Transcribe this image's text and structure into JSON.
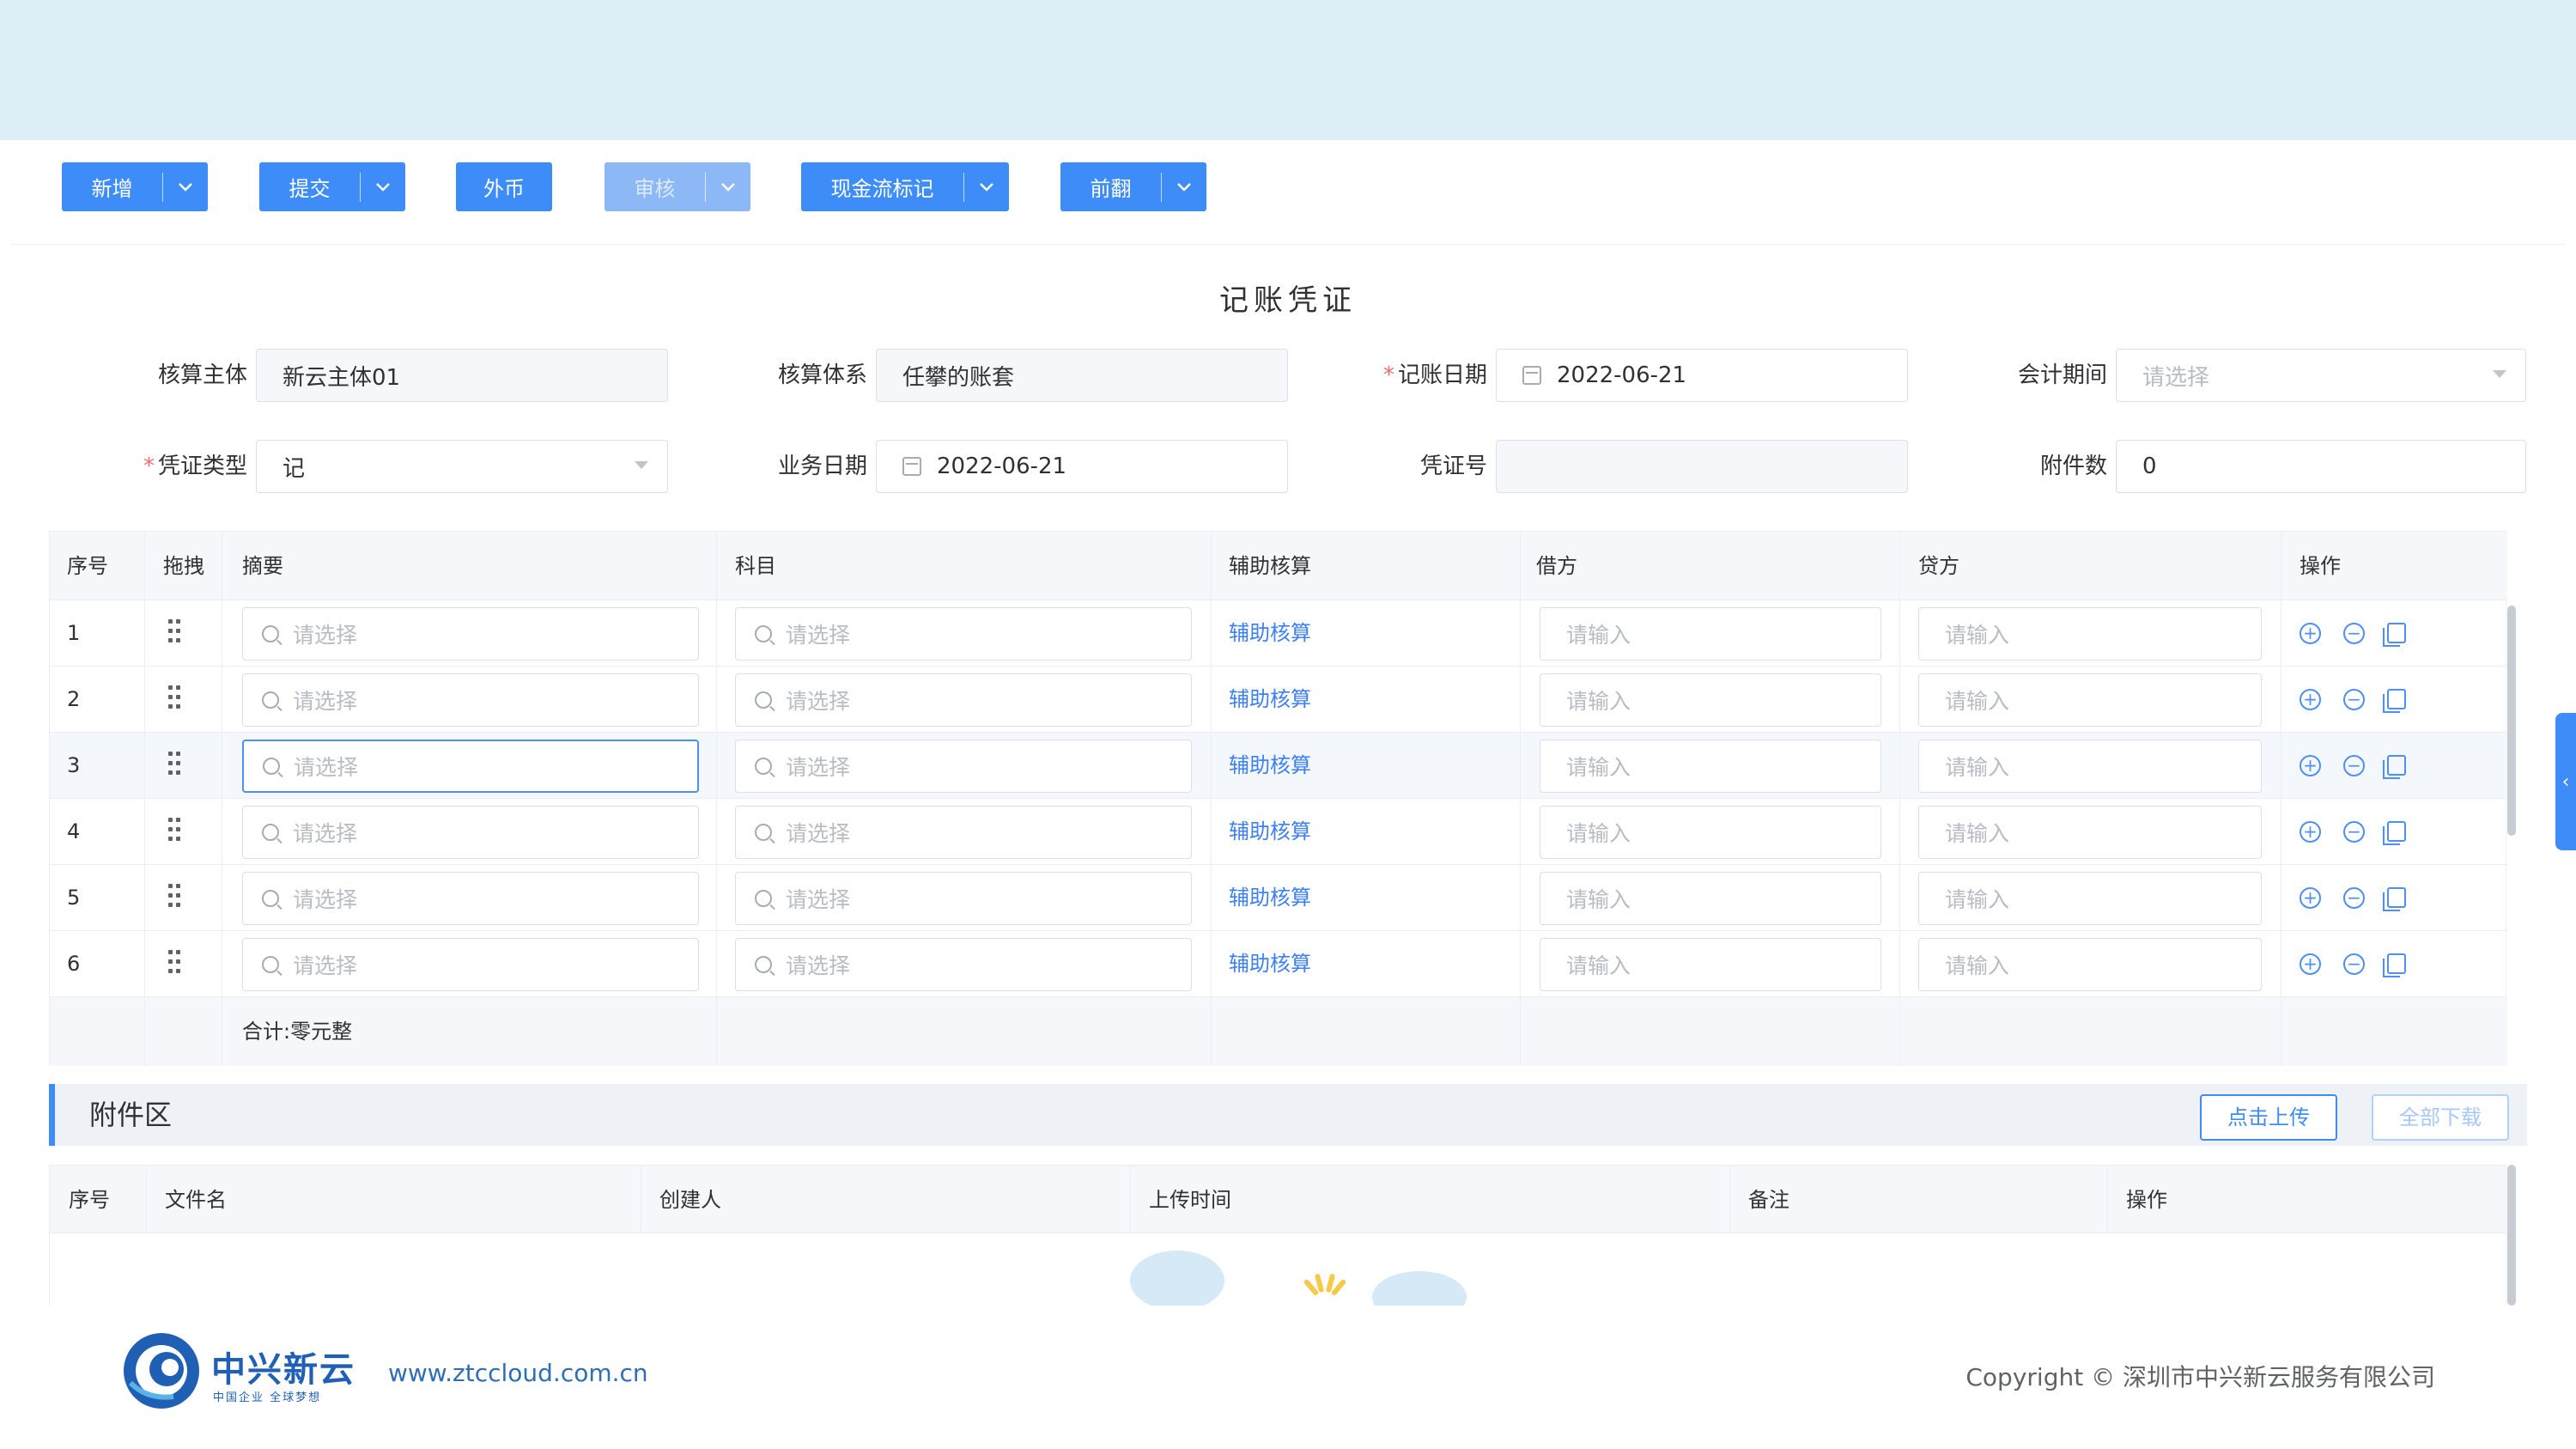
{
  "toolbar": {
    "buttons": [
      {
        "label": "新增"
      },
      {
        "label": "提交"
      },
      {
        "label": "外币"
      },
      {
        "label": "审核"
      },
      {
        "label": "现金流标记"
      },
      {
        "label": "前翻"
      }
    ]
  },
  "voucher": {
    "title": "记账凭证",
    "fields": {
      "entity": {
        "label": "核算主体",
        "value": "新云主体01"
      },
      "system": {
        "label": "核算体系",
        "value": "任攀的账套"
      },
      "posting_date": {
        "label": "记账日期",
        "value": "2022-06-21",
        "required": true
      },
      "period": {
        "label": "会计期间",
        "placeholder": "请选择"
      },
      "voucher_type": {
        "label": "凭证类型",
        "value": "记",
        "required": true
      },
      "business_date": {
        "label": "业务日期",
        "value": "2022-06-21"
      },
      "voucher_no": {
        "label": "凭证号",
        "value": ""
      },
      "attachments": {
        "label": "附件数",
        "value": "0"
      }
    }
  },
  "entries": {
    "headers": {
      "no": "序号",
      "drag": "拖拽",
      "summary": "摘要",
      "account": "科目",
      "aux": "辅助核算",
      "debit": "借方",
      "credit": "贷方",
      "ops": "操作"
    },
    "rows": [
      {
        "no": "1",
        "summary_ph": "请选择",
        "account_ph": "请选择",
        "aux": "辅助核算",
        "debit_ph": "请输入",
        "credit_ph": "请输入"
      },
      {
        "no": "2",
        "summary_ph": "请选择",
        "account_ph": "请选择",
        "aux": "辅助核算",
        "debit_ph": "请输入",
        "credit_ph": "请输入"
      },
      {
        "no": "3",
        "summary_ph": "请选择",
        "account_ph": "请选择",
        "aux": "辅助核算",
        "debit_ph": "请输入",
        "credit_ph": "请输入"
      },
      {
        "no": "4",
        "summary_ph": "请选择",
        "account_ph": "请选择",
        "aux": "辅助核算",
        "debit_ph": "请输入",
        "credit_ph": "请输入"
      },
      {
        "no": "5",
        "summary_ph": "请选择",
        "account_ph": "请选择",
        "aux": "辅助核算",
        "debit_ph": "请输入",
        "credit_ph": "请输入"
      },
      {
        "no": "6",
        "summary_ph": "请选择",
        "account_ph": "请选择",
        "aux": "辅助核算",
        "debit_ph": "请输入",
        "credit_ph": "请输入"
      }
    ],
    "total": "合计:零元整"
  },
  "attachments": {
    "title": "附件区",
    "upload_label": "点击上传",
    "download_all_label": "全部下载",
    "headers": {
      "no": "序号",
      "filename": "文件名",
      "creator": "创建人",
      "upload_time": "上传时间",
      "remark": "备注",
      "ops": "操作"
    }
  },
  "footer": {
    "brand": "中兴新云",
    "slogan": "中国企业 全球梦想",
    "website": "www.ztccloud.com.cn",
    "copyright": "Copyright © 深圳市中兴新云服务有限公司"
  },
  "colors": {
    "primary": "#3d8cf7",
    "banner": "#ddeef6",
    "link": "#3d7ff6",
    "required": "#f56c6c"
  }
}
